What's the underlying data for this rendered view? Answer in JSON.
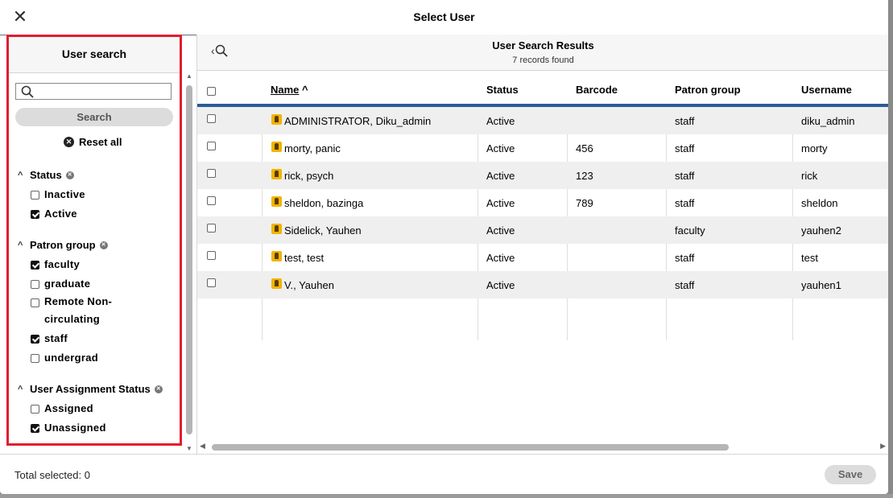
{
  "modal": {
    "title": "Select User",
    "close_icon": "close-icon"
  },
  "filters": {
    "header": "User search",
    "search": {
      "value": "",
      "placeholder": "",
      "button_label": "Search"
    },
    "reset_all_label": "Reset all",
    "groups": [
      {
        "title": "Status",
        "options": [
          {
            "label": "Inactive",
            "checked": false
          },
          {
            "label": "Active",
            "checked": true
          }
        ]
      },
      {
        "title": "Patron group",
        "options": [
          {
            "label": "faculty",
            "checked": true
          },
          {
            "label": "graduate",
            "checked": false
          },
          {
            "label_line1": "Remote Non-",
            "label_line2": "circulating",
            "checked": false
          },
          {
            "label": "staff",
            "checked": true
          },
          {
            "label": "undergrad",
            "checked": false
          }
        ]
      },
      {
        "title": "User Assignment Status",
        "options": [
          {
            "label": "Assigned",
            "checked": false
          },
          {
            "label": "Unassigned",
            "checked": true
          }
        ]
      }
    ]
  },
  "results": {
    "title": "User Search Results",
    "subtitle": "7 records found",
    "columns": [
      "Name",
      "Status",
      "Barcode",
      "Patron group",
      "Username"
    ],
    "rows": [
      {
        "name": "ADMINISTRATOR, Diku_admin",
        "status": "Active",
        "barcode": "",
        "patron_group": "staff",
        "username": "diku_admin"
      },
      {
        "name": "morty, panic",
        "status": "Active",
        "barcode": "456",
        "patron_group": "staff",
        "username": "morty"
      },
      {
        "name": "rick, psych",
        "status": "Active",
        "barcode": "123",
        "patron_group": "staff",
        "username": "rick"
      },
      {
        "name": "sheldon, bazinga",
        "status": "Active",
        "barcode": "789",
        "patron_group": "staff",
        "username": "sheldon"
      },
      {
        "name": "Sidelick, Yauhen",
        "status": "Active",
        "barcode": "",
        "patron_group": "faculty",
        "username": "yauhen2"
      },
      {
        "name": "test, test",
        "status": "Active",
        "barcode": "",
        "patron_group": "staff",
        "username": "test"
      },
      {
        "name": "V., Yauhen",
        "status": "Active",
        "barcode": "",
        "patron_group": "staff",
        "username": "yauhen1"
      }
    ]
  },
  "footer": {
    "total_selected": "Total selected: 0",
    "save_label": "Save"
  },
  "colors": {
    "highlight_border": "#e01e2e",
    "header_rule": "#2a5c96",
    "user_icon": "#f1b400"
  }
}
